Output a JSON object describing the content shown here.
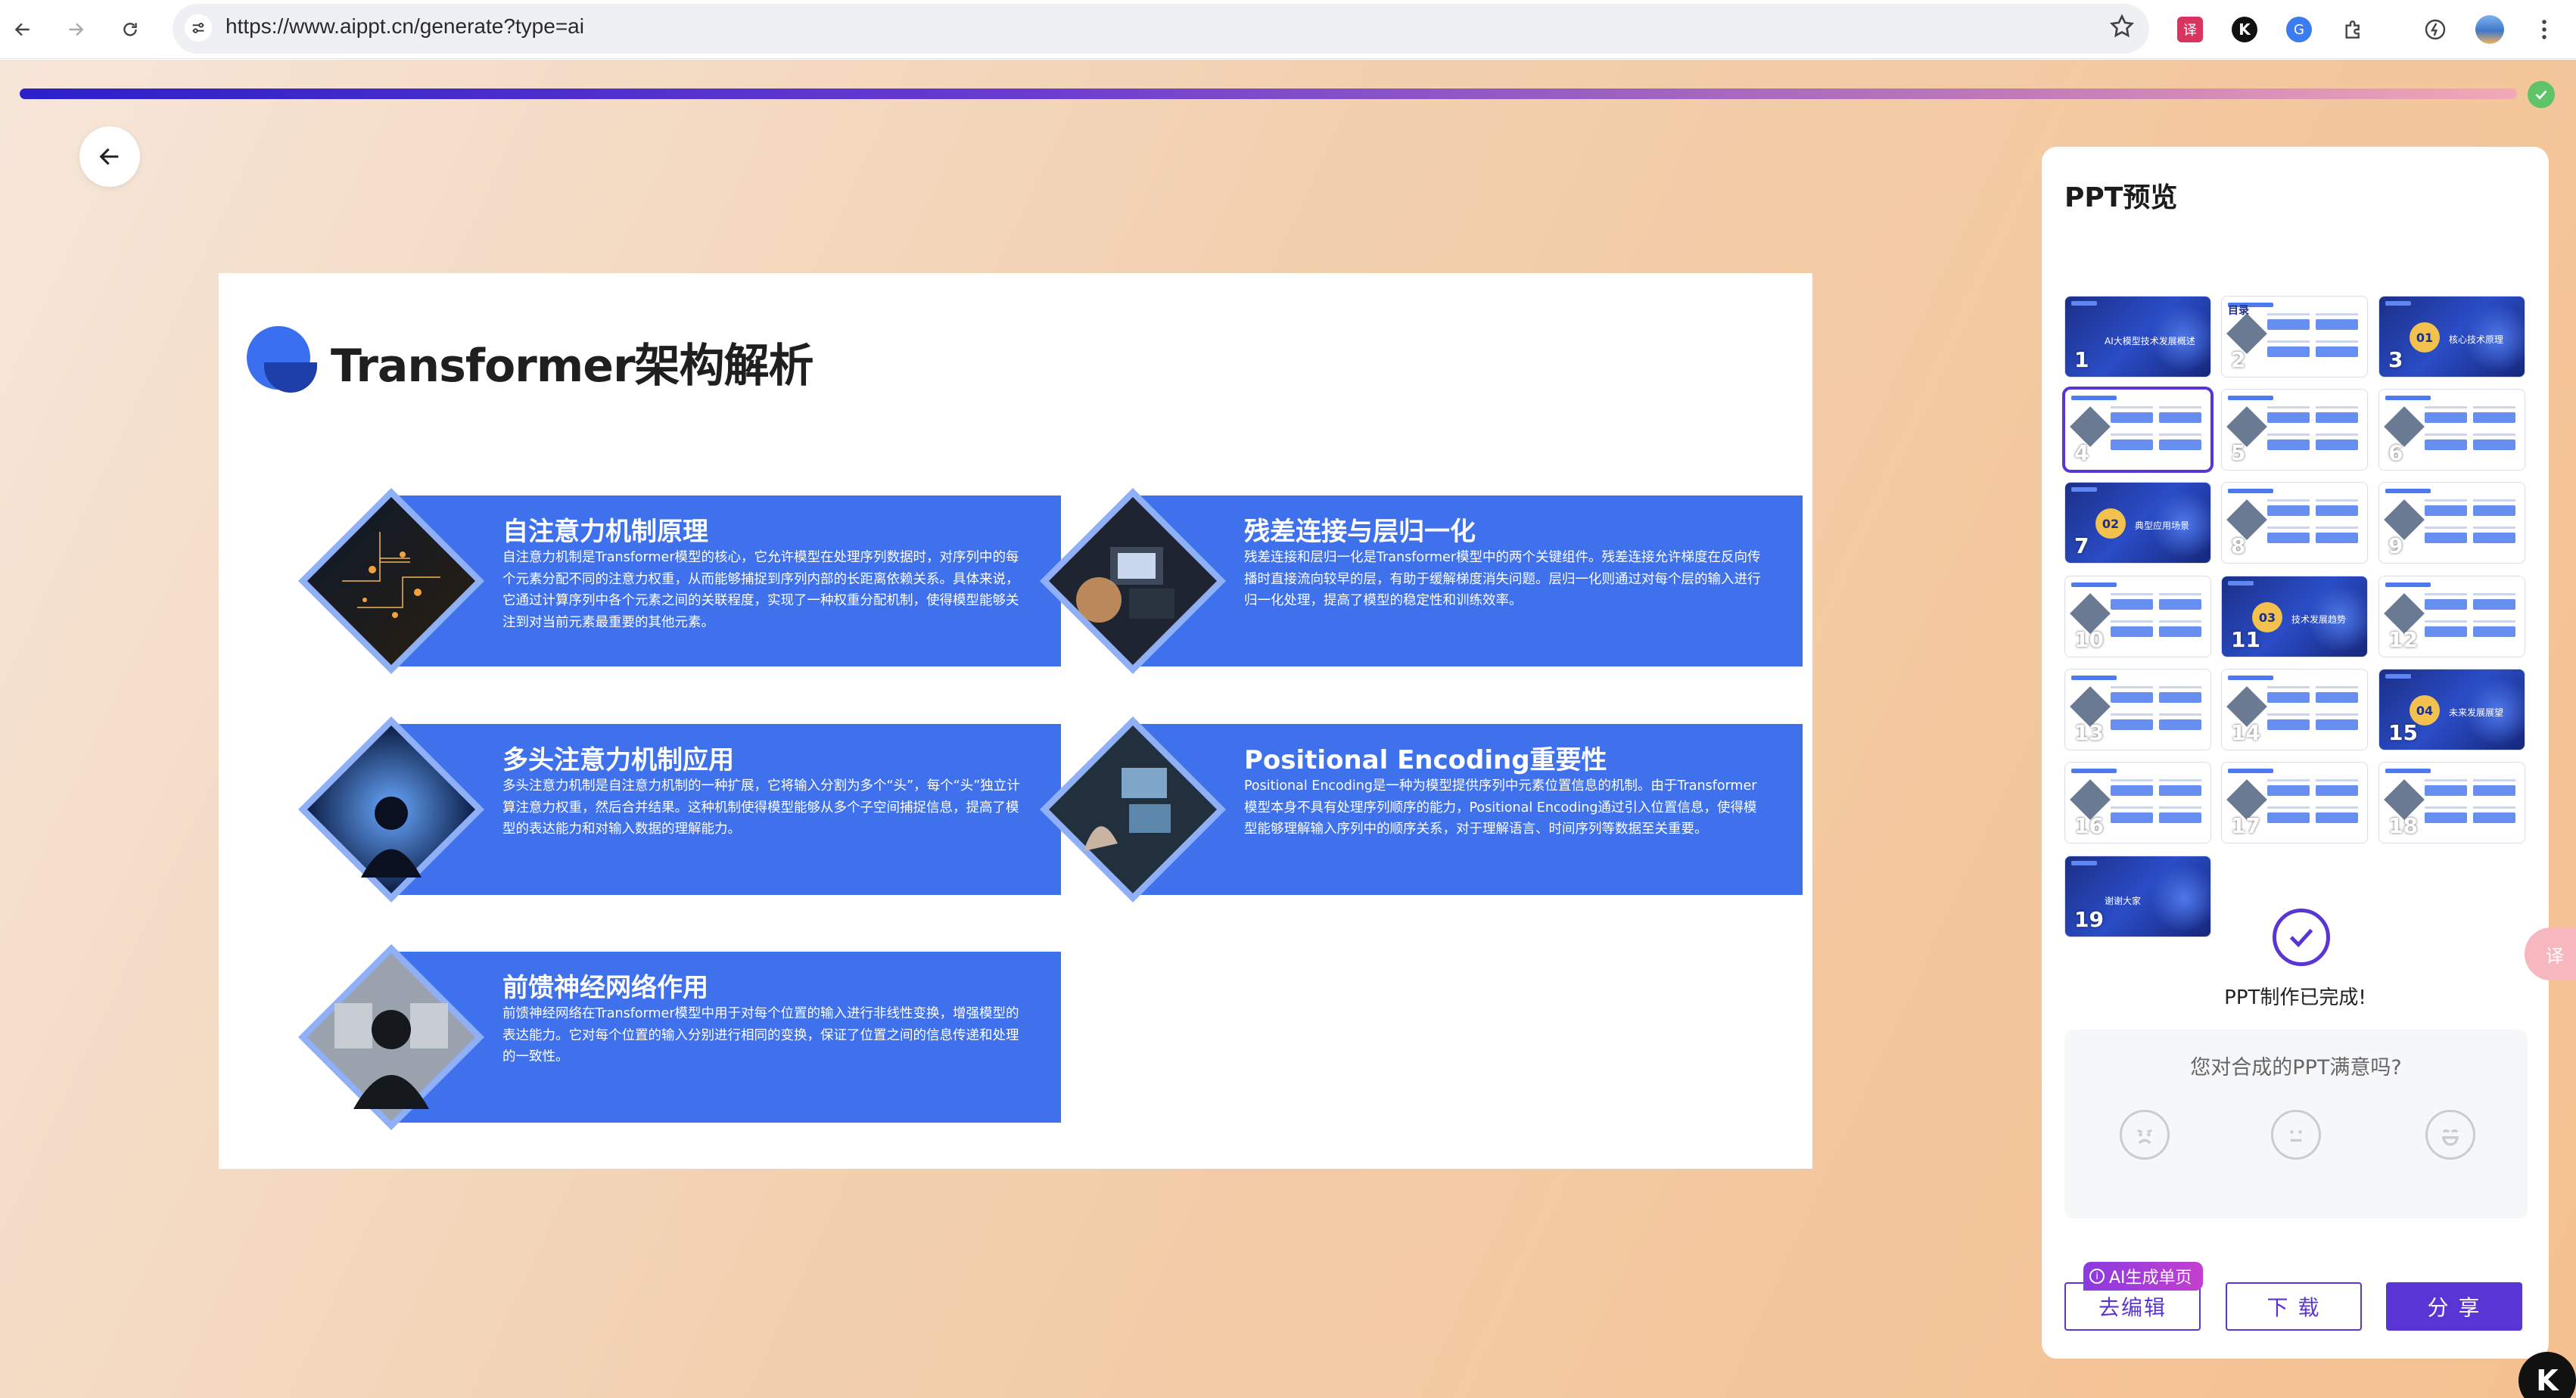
{
  "browser": {
    "url": "https://www.aippt.cn/generate?type=ai",
    "back_icon": "arrow-left-icon",
    "forward_icon": "arrow-right-icon",
    "reload_icon": "reload-icon",
    "site_info_icon": "tune-icon",
    "bookmark_icon": "star-icon",
    "extensions": [
      "translate-extension-icon",
      "k-extension-icon",
      "g-extension-icon",
      "puzzle-icon",
      "performance-icon",
      "profile-avatar"
    ]
  },
  "progress": {
    "value": 1.0,
    "done_icon": "check-icon"
  },
  "slide": {
    "title": "Transformer架构解析",
    "cards": [
      {
        "title": "自注意力机制原理",
        "body": "自注意力机制是Transformer模型的核心，它允许模型在处理序列数据时，对序列中的每个元素分配不同的注意力权重，从而能够捕捉到序列内部的长距离依赖关系。具体来说，它通过计算序列中各个元素之间的关联程度，实现了一种权重分配机制，使得模型能够关注到对当前元素最重要的其他元素。"
      },
      {
        "title": "残差连接与层归一化",
        "body": "残差连接和层归一化是Transformer模型中的两个关键组件。残差连接允许梯度在反向传播时直接流向较早的层，有助于缓解梯度消失问题。层归一化则通过对每个层的输入进行归一化处理，提高了模型的稳定性和训练效率。"
      },
      {
        "title": "多头注意力机制应用",
        "body": "多头注意力机制是自注意力机制的一种扩展，它将输入分割为多个“头”，每个“头”独立计算注意力权重，然后合并结果。这种机制使得模型能够从多个子空间捕捉信息，提高了模型的表达能力和对输入数据的理解能力。"
      },
      {
        "title": "Positional Encoding重要性",
        "body": "Positional Encoding是一种为模型提供序列中元素位置信息的机制。由于Transformer模型本身不具有处理序列顺序的能力，Positional Encoding通过引入位置信息，使得模型能够理解输入序列中的顺序关系，对于理解语言、时间序列等数据至关重要。"
      },
      {
        "title": "前馈神经网络作用",
        "body": "前馈神经网络在Transformer模型中用于对每个位置的输入进行非线性变换，增强模型的表达能力。它对每个位置的输入分别进行相同的变换，保证了位置之间的信息传递和处理的一致性。"
      }
    ]
  },
  "panel": {
    "title": "PPT预览",
    "thumbs": [
      {
        "num": "1",
        "style": "dark",
        "caption": "AI大模型技术发展概述"
      },
      {
        "num": "2",
        "style": "light",
        "caption": "目录"
      },
      {
        "num": "3",
        "style": "dark",
        "caption": "核心技术原理",
        "badge": "01"
      },
      {
        "num": "4",
        "style": "light",
        "caption": ""
      },
      {
        "num": "5",
        "style": "light",
        "caption": ""
      },
      {
        "num": "6",
        "style": "light",
        "caption": ""
      },
      {
        "num": "7",
        "style": "dark",
        "caption": "典型应用场景",
        "badge": "02"
      },
      {
        "num": "8",
        "style": "light",
        "caption": ""
      },
      {
        "num": "9",
        "style": "light",
        "caption": ""
      },
      {
        "num": "10",
        "style": "light",
        "caption": ""
      },
      {
        "num": "11",
        "style": "dark",
        "caption": "技术发展趋势",
        "badge": "03"
      },
      {
        "num": "12",
        "style": "light",
        "caption": ""
      },
      {
        "num": "13",
        "style": "light",
        "caption": ""
      },
      {
        "num": "14",
        "style": "light",
        "caption": ""
      },
      {
        "num": "15",
        "style": "dark",
        "caption": "未来发展展望",
        "badge": "04"
      },
      {
        "num": "16",
        "style": "light",
        "caption": ""
      },
      {
        "num": "17",
        "style": "light",
        "caption": ""
      },
      {
        "num": "18",
        "style": "light",
        "caption": ""
      },
      {
        "num": "19",
        "style": "dark",
        "caption": "谢谢大家"
      }
    ],
    "done_text": "PPT制作已完成!",
    "survey_question": "您对合成的PPT满意吗?",
    "faces": [
      "angry-face-icon",
      "neutral-face-icon",
      "happy-face-icon"
    ],
    "ai_tag": "AI生成单页",
    "edit_label": "去编辑",
    "download_label": "下 载",
    "share_label": "分 享"
  },
  "corner_logo": "K",
  "colors": {
    "accent": "#5a35d6",
    "slide_blue": "#3f71ec",
    "progress_start": "#2b20c9",
    "progress_end": "#f2a9b6"
  }
}
